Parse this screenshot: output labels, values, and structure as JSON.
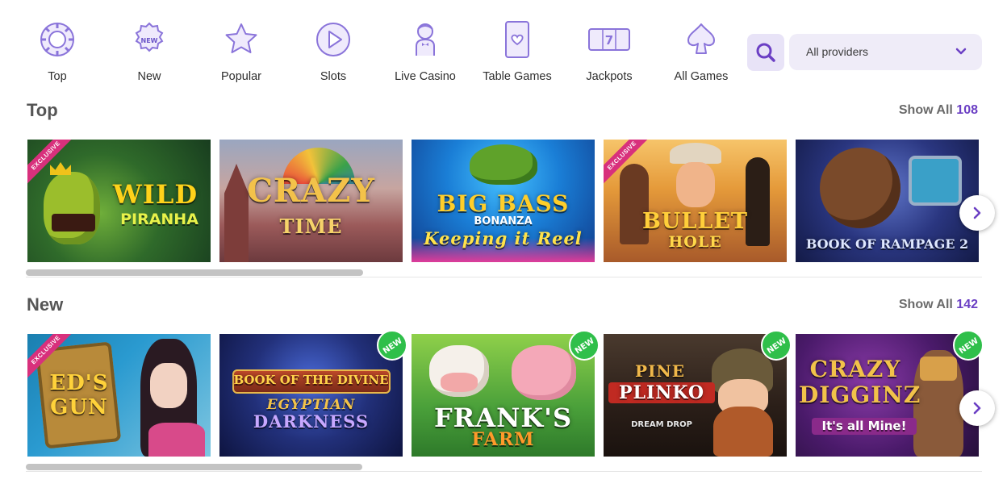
{
  "nav": {
    "categories": [
      {
        "label": "Top",
        "icon": "top-chip-icon"
      },
      {
        "label": "New",
        "icon": "new-badge-icon"
      },
      {
        "label": "Popular",
        "icon": "star-icon"
      },
      {
        "label": "Slots",
        "icon": "play-icon"
      },
      {
        "label": "Live Casino",
        "icon": "dealer-icon"
      },
      {
        "label": "Table Games",
        "icon": "playing-card-icon"
      },
      {
        "label": "Jackpots",
        "icon": "slot-777-icon"
      },
      {
        "label": "All Games",
        "icon": "spade-icon"
      }
    ],
    "icon_color": "#7b62d4",
    "search_icon": "search-icon",
    "provider_select": {
      "value": "All providers"
    }
  },
  "sections": [
    {
      "title": "Top",
      "show_all_label": "Show All",
      "count": "108",
      "games": [
        {
          "title": "WILD",
          "subtitle": "PIRANHA",
          "exclusive": "EXCLUSIVE",
          "new": ""
        },
        {
          "title": "CRAZY",
          "subtitle": "TIME",
          "exclusive": "",
          "new": ""
        },
        {
          "title": "BIG BASS",
          "subtitle": "BONANZA",
          "tagline": "Keeping it Reel",
          "exclusive": "",
          "new": ""
        },
        {
          "title": "BULLET",
          "subtitle": "HOLE",
          "exclusive": "EXCLUSIVE",
          "new": ""
        },
        {
          "title": "BOOK OF RAMPAGE 2",
          "subtitle": "",
          "exclusive": "",
          "new": ""
        }
      ]
    },
    {
      "title": "New",
      "show_all_label": "Show All",
      "count": "142",
      "games": [
        {
          "title": "ED'S",
          "subtitle": "GUN",
          "exclusive": "EXCLUSIVE",
          "new": ""
        },
        {
          "title": "BOOK OF THE DIVINE",
          "subtitle": "EGYPTIAN",
          "tagline": "DARKNESS",
          "exclusive": "",
          "new": "NEW"
        },
        {
          "title": "FRANK'S",
          "subtitle": "FARM",
          "exclusive": "",
          "new": "NEW"
        },
        {
          "title": "PINE",
          "subtitle": "PLINKO",
          "tagline": "DREAM DROP",
          "exclusive": "",
          "new": "NEW"
        },
        {
          "title": "CRAZY",
          "subtitle": "DIGGINZ",
          "tagline": "It's all Mine!",
          "exclusive": "",
          "new": "NEW"
        }
      ]
    }
  ],
  "colors": {
    "accent": "#6b3fc4",
    "ribbon": "#d8307c",
    "new_badge": "#2fbf4a"
  }
}
